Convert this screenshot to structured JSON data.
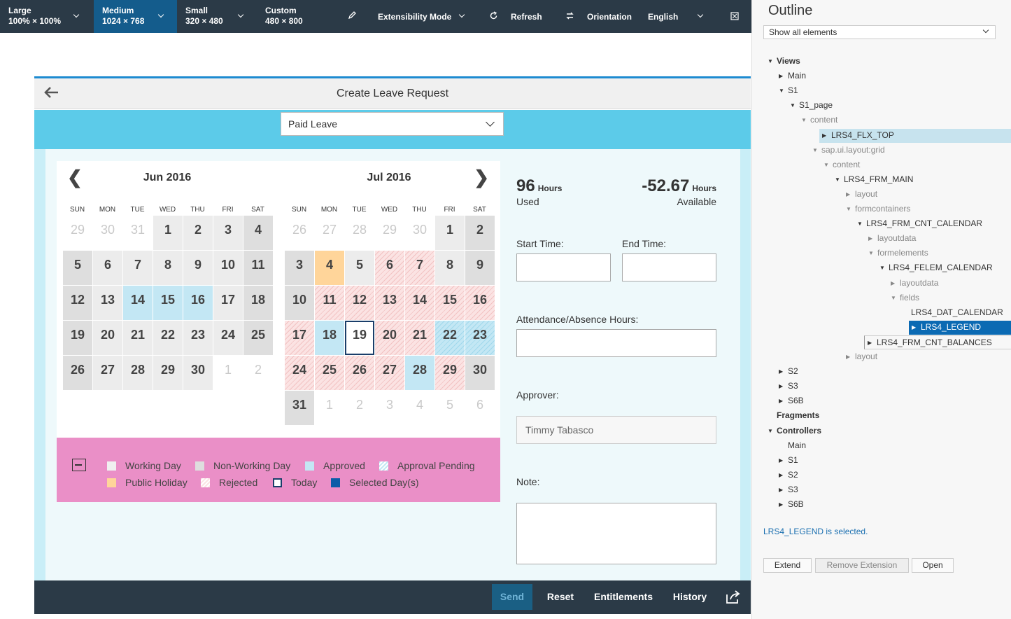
{
  "topbar": {
    "sizes": [
      {
        "name": "Large",
        "dims": "100% × 100%",
        "selected": false
      },
      {
        "name": "Medium",
        "dims": "1024 × 768",
        "selected": true
      },
      {
        "name": "Small",
        "dims": "320 × 480",
        "selected": false
      },
      {
        "name": "Custom",
        "dims": "480 × 800",
        "selected": false
      }
    ],
    "extensibility_label": "Extensibility Mode",
    "refresh_label": "Refresh",
    "orientation_label": "Orientation",
    "language_label": "English",
    "icons": {
      "edit": "pencil-icon",
      "refresh": "refresh-icon",
      "orientation": "rotate-icon",
      "fullscreen": "fullscreen-icon"
    }
  },
  "app": {
    "title": "Create Leave Request",
    "leave_type": "Paid Leave",
    "calendar": {
      "months": [
        "Jun 2016",
        "Jul 2016"
      ],
      "weekdays": [
        "SUN",
        "MON",
        "TUE",
        "WED",
        "THU",
        "FRI",
        "SAT"
      ],
      "jun": [
        [
          {
            "d": "29",
            "s": "om"
          },
          {
            "d": "30",
            "s": "om"
          },
          {
            "d": "31",
            "s": "om"
          },
          {
            "d": "1",
            "s": "wd"
          },
          {
            "d": "2",
            "s": "wd"
          },
          {
            "d": "3",
            "s": "wd"
          },
          {
            "d": "4",
            "s": "nw"
          }
        ],
        [
          {
            "d": "5",
            "s": "nw"
          },
          {
            "d": "6",
            "s": "wd"
          },
          {
            "d": "7",
            "s": "wd"
          },
          {
            "d": "8",
            "s": "wd"
          },
          {
            "d": "9",
            "s": "wd"
          },
          {
            "d": "10",
            "s": "wd"
          },
          {
            "d": "11",
            "s": "nw"
          }
        ],
        [
          {
            "d": "12",
            "s": "nw"
          },
          {
            "d": "13",
            "s": "wd"
          },
          {
            "d": "14",
            "s": "ap"
          },
          {
            "d": "15",
            "s": "ap"
          },
          {
            "d": "16",
            "s": "ap"
          },
          {
            "d": "17",
            "s": "wd"
          },
          {
            "d": "18",
            "s": "nw"
          }
        ],
        [
          {
            "d": "19",
            "s": "nw"
          },
          {
            "d": "20",
            "s": "wd"
          },
          {
            "d": "21",
            "s": "wd"
          },
          {
            "d": "22",
            "s": "wd"
          },
          {
            "d": "23",
            "s": "wd"
          },
          {
            "d": "24",
            "s": "wd"
          },
          {
            "d": "25",
            "s": "nw"
          }
        ],
        [
          {
            "d": "26",
            "s": "nw"
          },
          {
            "d": "27",
            "s": "wd"
          },
          {
            "d": "28",
            "s": "wd"
          },
          {
            "d": "29",
            "s": "wd"
          },
          {
            "d": "30",
            "s": "wd"
          },
          {
            "d": "1",
            "s": "om"
          },
          {
            "d": "2",
            "s": "om"
          }
        ]
      ],
      "jul": [
        [
          {
            "d": "26",
            "s": "om"
          },
          {
            "d": "27",
            "s": "om"
          },
          {
            "d": "28",
            "s": "om"
          },
          {
            "d": "29",
            "s": "om"
          },
          {
            "d": "30",
            "s": "om"
          },
          {
            "d": "1",
            "s": "wd"
          },
          {
            "d": "2",
            "s": "nw"
          }
        ],
        [
          {
            "d": "3",
            "s": "nw"
          },
          {
            "d": "4",
            "s": "ph"
          },
          {
            "d": "5",
            "s": "wd"
          },
          {
            "d": "6",
            "s": "rj"
          },
          {
            "d": "7",
            "s": "rj"
          },
          {
            "d": "8",
            "s": "wd"
          },
          {
            "d": "9",
            "s": "nw"
          }
        ],
        [
          {
            "d": "10",
            "s": "nw"
          },
          {
            "d": "11",
            "s": "rj"
          },
          {
            "d": "12",
            "s": "rj"
          },
          {
            "d": "13",
            "s": "rj"
          },
          {
            "d": "14",
            "s": "rj"
          },
          {
            "d": "15",
            "s": "rj"
          },
          {
            "d": "16",
            "s": "rj"
          }
        ],
        [
          {
            "d": "17",
            "s": "rj"
          },
          {
            "d": "18",
            "s": "ap"
          },
          {
            "d": "19",
            "s": "td"
          },
          {
            "d": "20",
            "s": "rj"
          },
          {
            "d": "21",
            "s": "rj"
          },
          {
            "d": "22",
            "s": "pe"
          },
          {
            "d": "23",
            "s": "pe"
          }
        ],
        [
          {
            "d": "24",
            "s": "rj"
          },
          {
            "d": "25",
            "s": "rj"
          },
          {
            "d": "26",
            "s": "rj"
          },
          {
            "d": "27",
            "s": "rj"
          },
          {
            "d": "28",
            "s": "ap"
          },
          {
            "d": "29",
            "s": "rj"
          },
          {
            "d": "30",
            "s": "nw"
          }
        ],
        [
          {
            "d": "31",
            "s": "nw"
          },
          {
            "d": "1",
            "s": "om"
          },
          {
            "d": "2",
            "s": "om"
          },
          {
            "d": "3",
            "s": "om"
          },
          {
            "d": "4",
            "s": "om"
          },
          {
            "d": "5",
            "s": "om"
          },
          {
            "d": "6",
            "s": "om"
          }
        ]
      ]
    },
    "legend": [
      {
        "label": "Working Day",
        "key": "wd"
      },
      {
        "label": "Non-Working Day",
        "key": "nw"
      },
      {
        "label": "Approved",
        "key": "ap"
      },
      {
        "label": "Approval Pending",
        "key": "pe"
      },
      {
        "label": "Public Holiday",
        "key": "ph"
      },
      {
        "label": "Rejected",
        "key": "rj"
      },
      {
        "label": "Today",
        "key": "td"
      },
      {
        "label": "Selected Day(s)",
        "key": "sel"
      }
    ],
    "used": {
      "value": "96",
      "unit": "Hours",
      "label": "Used"
    },
    "available": {
      "value": "-52.67",
      "unit": "Hours",
      "label": "Available"
    },
    "start_time_label": "Start Time:",
    "end_time_label": "End Time:",
    "hours_label": "Attendance/Absence Hours:",
    "approver_label": "Approver:",
    "approver_value": "Timmy Tabasco",
    "note_label": "Note:",
    "footer": {
      "send": "Send",
      "reset": "Reset",
      "entitlements": "Entitlements",
      "history": "History"
    }
  },
  "outline": {
    "title": "Outline",
    "filter": "Show all elements",
    "status": "LRS4_LEGEND is selected.",
    "buttons": {
      "extend": "Extend",
      "remove": "Remove Extension",
      "open": "Open"
    },
    "tree": [
      {
        "label": "Views",
        "lvl": 0,
        "ar": "down",
        "st": "b"
      },
      {
        "label": "Main",
        "lvl": 1,
        "ar": "right",
        "st": ""
      },
      {
        "label": "S1",
        "lvl": 1,
        "ar": "down",
        "st": ""
      },
      {
        "label": "S1_page",
        "lvl": 2,
        "ar": "down",
        "st": ""
      },
      {
        "label": "content",
        "lvl": 3,
        "ar": "down",
        "st": "g"
      },
      {
        "label": "LRS4_FLX_TOP",
        "lvl": 4,
        "ar": "right",
        "st": "hl"
      },
      {
        "label": "sap.ui.layout:grid",
        "lvl": 4,
        "ar": "down",
        "st": "g"
      },
      {
        "label": "content",
        "lvl": 5,
        "ar": "down",
        "st": "g"
      },
      {
        "label": "LRS4_FRM_MAIN",
        "lvl": 6,
        "ar": "down",
        "st": ""
      },
      {
        "label": "layout",
        "lvl": 7,
        "ar": "right",
        "st": "g"
      },
      {
        "label": "formcontainers",
        "lvl": 7,
        "ar": "down",
        "st": "g"
      },
      {
        "label": "LRS4_FRM_CNT_CALENDAR",
        "lvl": 8,
        "ar": "down",
        "st": ""
      },
      {
        "label": "layoutdata",
        "lvl": 9,
        "ar": "right",
        "st": "g"
      },
      {
        "label": "formelements",
        "lvl": 9,
        "ar": "down",
        "st": "g"
      },
      {
        "label": "LRS4_FELEM_CALENDAR",
        "lvl": 10,
        "ar": "down",
        "st": ""
      },
      {
        "label": "layoutdata",
        "lvl": 11,
        "ar": "right",
        "st": "g"
      },
      {
        "label": "fields",
        "lvl": 11,
        "ar": "down",
        "st": "g"
      },
      {
        "label": "LRS4_DAT_CALENDAR",
        "lvl": 12,
        "ar": "",
        "st": ""
      },
      {
        "label": "LRS4_LEGEND",
        "lvl": 12,
        "ar": "right",
        "st": "sel"
      },
      {
        "label": "LRS4_FRM_CNT_BALANCES",
        "lvl": 8,
        "ar": "right",
        "st": "box"
      },
      {
        "label": "layout",
        "lvl": 7,
        "ar": "right",
        "st": "g"
      },
      {
        "label": "S2",
        "lvl": 1,
        "ar": "right",
        "st": ""
      },
      {
        "label": "S3",
        "lvl": 1,
        "ar": "right",
        "st": ""
      },
      {
        "label": "S6B",
        "lvl": 1,
        "ar": "right",
        "st": ""
      },
      {
        "label": "Fragments",
        "lvl": 0,
        "ar": "",
        "st": "b"
      },
      {
        "label": "Controllers",
        "lvl": 0,
        "ar": "down",
        "st": "b"
      },
      {
        "label": "Main",
        "lvl": 1,
        "ar": "",
        "st": ""
      },
      {
        "label": "S1",
        "lvl": 1,
        "ar": "right",
        "st": ""
      },
      {
        "label": "S2",
        "lvl": 1,
        "ar": "right",
        "st": ""
      },
      {
        "label": "S3",
        "lvl": 1,
        "ar": "right",
        "st": ""
      },
      {
        "label": "S6B",
        "lvl": 1,
        "ar": "right",
        "st": ""
      }
    ]
  }
}
